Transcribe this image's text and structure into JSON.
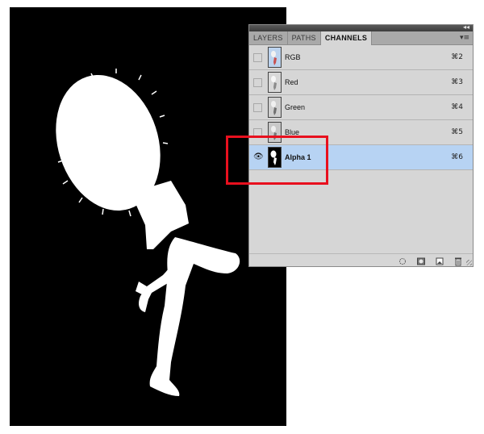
{
  "panel": {
    "tabs": [
      {
        "label": "LAYERS",
        "active": false
      },
      {
        "label": "PATHS",
        "active": false
      },
      {
        "label": "CHANNELS",
        "active": true
      }
    ],
    "collapse_icon": "double-chevron-icon",
    "menu_icon": "panel-menu-icon"
  },
  "channels": [
    {
      "name": "RGB",
      "shortcut": "⌘2",
      "visible": false,
      "selected": false
    },
    {
      "name": "Red",
      "shortcut": "⌘3",
      "visible": false,
      "selected": false
    },
    {
      "name": "Green",
      "shortcut": "⌘4",
      "visible": false,
      "selected": false
    },
    {
      "name": "Blue",
      "shortcut": "⌘5",
      "visible": false,
      "selected": false
    },
    {
      "name": "Alpha 1",
      "shortcut": "⌘6",
      "visible": true,
      "selected": true
    }
  ],
  "bottom_icons": [
    "load-selection-icon",
    "save-selection-icon",
    "new-channel-icon",
    "delete-channel-icon"
  ],
  "colors": {
    "selection": "#b7d3f3",
    "highlight": "#e8101e",
    "canvas": "#000000"
  }
}
